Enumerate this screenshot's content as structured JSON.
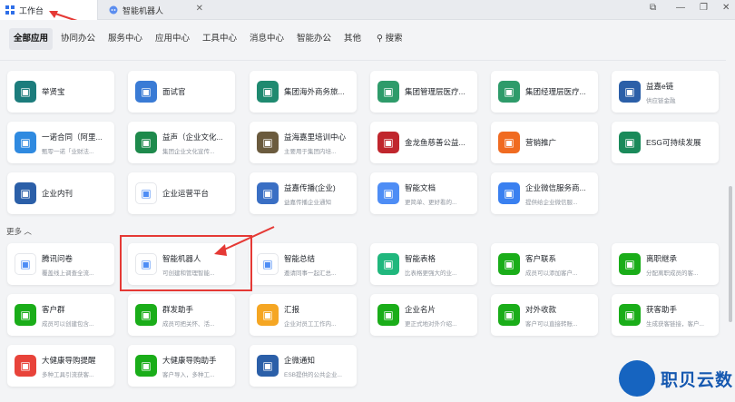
{
  "tabs": [
    {
      "label": "工作台"
    },
    {
      "label": "智能机器人"
    }
  ],
  "categories": [
    "全部应用",
    "协同办公",
    "服务中心",
    "应用中心",
    "工具中心",
    "消息中心",
    "智能办公",
    "其他",
    "搜索"
  ],
  "section_more": "更多",
  "top_apps": [
    {
      "name": "举贤宝",
      "desc": "",
      "icon": "teal-people-icon",
      "color": "#1c7c7c"
    },
    {
      "name": "面试官",
      "desc": "",
      "icon": "group-icon",
      "color": "#3a7bd5"
    },
    {
      "name": "集团海外商务旅...",
      "desc": "",
      "icon": "plane-icon",
      "color": "#1f8a70"
    },
    {
      "name": "集团管理层医疗...",
      "desc": "",
      "icon": "medical-badge-icon",
      "color": "#2e9b6a"
    },
    {
      "name": "集团经理层医疗...",
      "desc": "",
      "icon": "medical-badge-icon",
      "color": "#2e9b6a"
    },
    {
      "name": "益嘉e链",
      "desc": "供应链金融",
      "icon": "wilmar-logo-icon",
      "color": "#2b5fa8"
    },
    {
      "name": "一诺合同（阿里...",
      "desc": "甄零一诺「业财法...",
      "icon": "contract-icon",
      "color": "#2f8ae0"
    },
    {
      "name": "益声（企业文化...",
      "desc": "集团企业文化宣传...",
      "icon": "culture-icon",
      "color": "#1e8a4c"
    },
    {
      "name": "益海嘉里培训中心",
      "desc": "主要用于集团内培...",
      "icon": "training-icon",
      "color": "#6b5b3e"
    },
    {
      "name": "金龙鱼慈善公益...",
      "desc": "",
      "icon": "charity-icon",
      "color": "#c0262d"
    },
    {
      "name": "营销推广",
      "desc": "",
      "icon": "rocket-icon",
      "color": "#f06b21"
    },
    {
      "name": "ESG可持续发展",
      "desc": "",
      "icon": "esg-icon",
      "color": "#1a8a5a"
    },
    {
      "name": "企业内刊",
      "desc": "",
      "icon": "wilmar-logo-icon",
      "color": "#2b5fa8"
    },
    {
      "name": "企业运营平台",
      "desc": "",
      "icon": "platform-icon",
      "color": "#ffffff"
    },
    {
      "name": "益嘉传播(企业)",
      "desc": "益嘉传播企业通知",
      "icon": "doc-icon",
      "color": "#3a6fc4"
    },
    {
      "name": "智能文档",
      "desc": "更简单、更好看的...",
      "icon": "smart-doc-icon",
      "color": "#4e8df5"
    },
    {
      "name": "企业微信服务商...",
      "desc": "提供给企业微信服...",
      "icon": "chat-icon",
      "color": "#3a80f0"
    }
  ],
  "more_apps": [
    {
      "name": "腾讯问卷",
      "desc": "覆盖线上调查全流...",
      "icon": "check-icon",
      "color": "#ffffff"
    },
    {
      "name": "智能机器人",
      "desc": "可创建和管理智能...",
      "icon": "robot-icon",
      "color": "#ffffff"
    },
    {
      "name": "智能总结",
      "desc": "邀请同事一起汇总...",
      "icon": "sparkle-icon",
      "color": "#ffffff"
    },
    {
      "name": "智能表格",
      "desc": "比表格更强大的业...",
      "icon": "table-icon",
      "color": "#20b77d"
    },
    {
      "name": "客户联系",
      "desc": "成员可以添加客户...",
      "icon": "wechat-icon",
      "color": "#1aad19"
    },
    {
      "name": "离职继承",
      "desc": "分配离职成员的客...",
      "icon": "handover-icon",
      "color": "#1aad19"
    },
    {
      "name": "客户群",
      "desc": "成员可以创建包含...",
      "icon": "customer-group-icon",
      "color": "#1aad19"
    },
    {
      "name": "群发助手",
      "desc": "成员可把关怀、活...",
      "icon": "broadcast-icon",
      "color": "#1aad19"
    },
    {
      "name": "汇报",
      "desc": "企业对员工工作内...",
      "icon": "report-icon",
      "color": "#f5a623"
    },
    {
      "name": "企业名片",
      "desc": "更正式地对外介绍...",
      "icon": "card-icon",
      "color": "#1aad19"
    },
    {
      "name": "对外收款",
      "desc": "客户可以直接转账...",
      "icon": "payment-icon",
      "color": "#1aad19"
    },
    {
      "name": "获客助手",
      "desc": "生成获客链接，客户...",
      "icon": "acquire-icon",
      "color": "#1aad19"
    },
    {
      "name": "大健康导购提醒",
      "desc": "多种工具引流获客...",
      "icon": "bag-icon",
      "color": "#e8433a"
    },
    {
      "name": "大健康导购助手",
      "desc": "客户导入，多种工...",
      "icon": "assistant-icon",
      "color": "#1aad19"
    },
    {
      "name": "企微通知",
      "desc": "ESB提供的公共企业...",
      "icon": "wilmar-logo-icon",
      "color": "#2b5fa8"
    }
  ],
  "watermark": {
    "text": "职贝云数"
  }
}
